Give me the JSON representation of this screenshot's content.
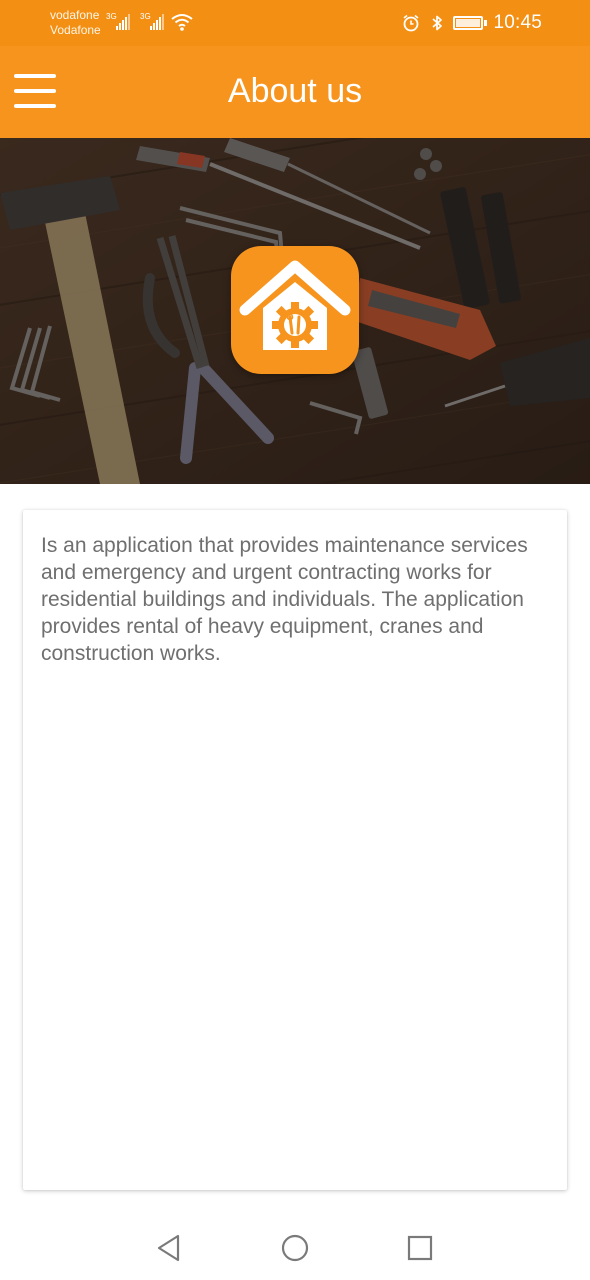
{
  "status_bar": {
    "carrier_1": "vodafone",
    "carrier_2": "Vodafone",
    "network_1": "3G",
    "network_2": "3G",
    "time": "10:45",
    "icons": [
      "signal-icon",
      "wifi-icon",
      "alarm-icon",
      "bluetooth-icon",
      "battery-icon"
    ]
  },
  "app_bar": {
    "title": "About us",
    "menu_icon": "hamburger-menu-icon"
  },
  "hero": {
    "background": "tools-on-wood-photo",
    "logo_icon": "house-gear-wrench-icon"
  },
  "about": {
    "text": "Is an application that provides maintenance services and emergency and urgent contracting works for residential buildings and individuals. The application provides rental of heavy equipment, cranes and construction works."
  },
  "nav_bar": {
    "icons": [
      "back-triangle-icon",
      "home-circle-icon",
      "recents-square-icon"
    ]
  },
  "colors": {
    "status_bar": "#f39014",
    "app_bar": "#f7941d",
    "text": "#6f6f6f",
    "background": "#ffffff"
  }
}
